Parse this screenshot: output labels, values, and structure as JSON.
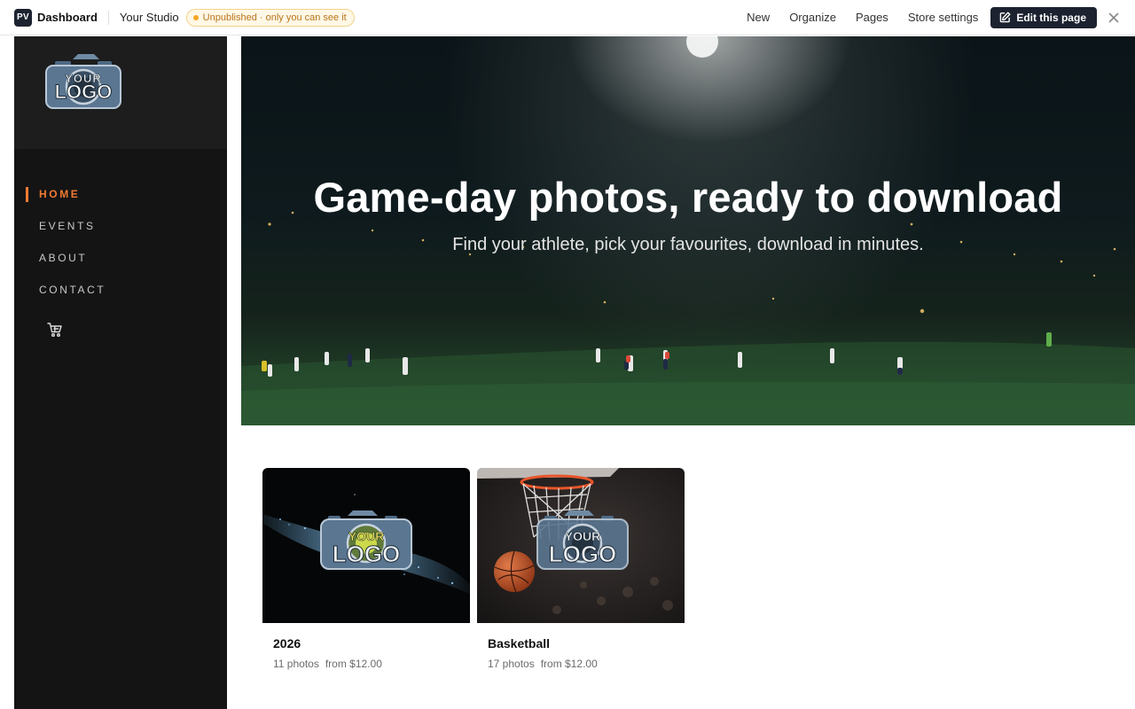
{
  "topbar": {
    "app_badge": "PV",
    "app_label": "Dashboard",
    "studio_name": "Your Studio",
    "status_badge": "Unpublished · only you can see it",
    "links": [
      "New",
      "Organize",
      "Pages",
      "Store settings"
    ],
    "edit_button": "Edit this page"
  },
  "brand": {
    "logo_line1": "YOUR",
    "logo_line2": "LOGO"
  },
  "sidebar": {
    "nav": [
      {
        "label": "HOME",
        "active": true
      },
      {
        "label": "EVENTS",
        "active": false
      },
      {
        "label": "ABOUT",
        "active": false
      },
      {
        "label": "CONTACT",
        "active": false
      }
    ],
    "cart_icon": "shopping-cart-icon"
  },
  "hero": {
    "title": "Game-day photos, ready to download",
    "subtitle": "Find your athlete, pick your favourites, download in minutes."
  },
  "galleries": [
    {
      "title": "2026",
      "photos": "11 photos",
      "price": "from $12.00"
    },
    {
      "title": "Basketball",
      "photos": "17 photos",
      "price": "from $12.00"
    }
  ],
  "colors": {
    "accent": "#f07a33",
    "dark_button": "#1c2230",
    "sidebar_bg": "#141414",
    "badge_text": "#b8741a"
  }
}
